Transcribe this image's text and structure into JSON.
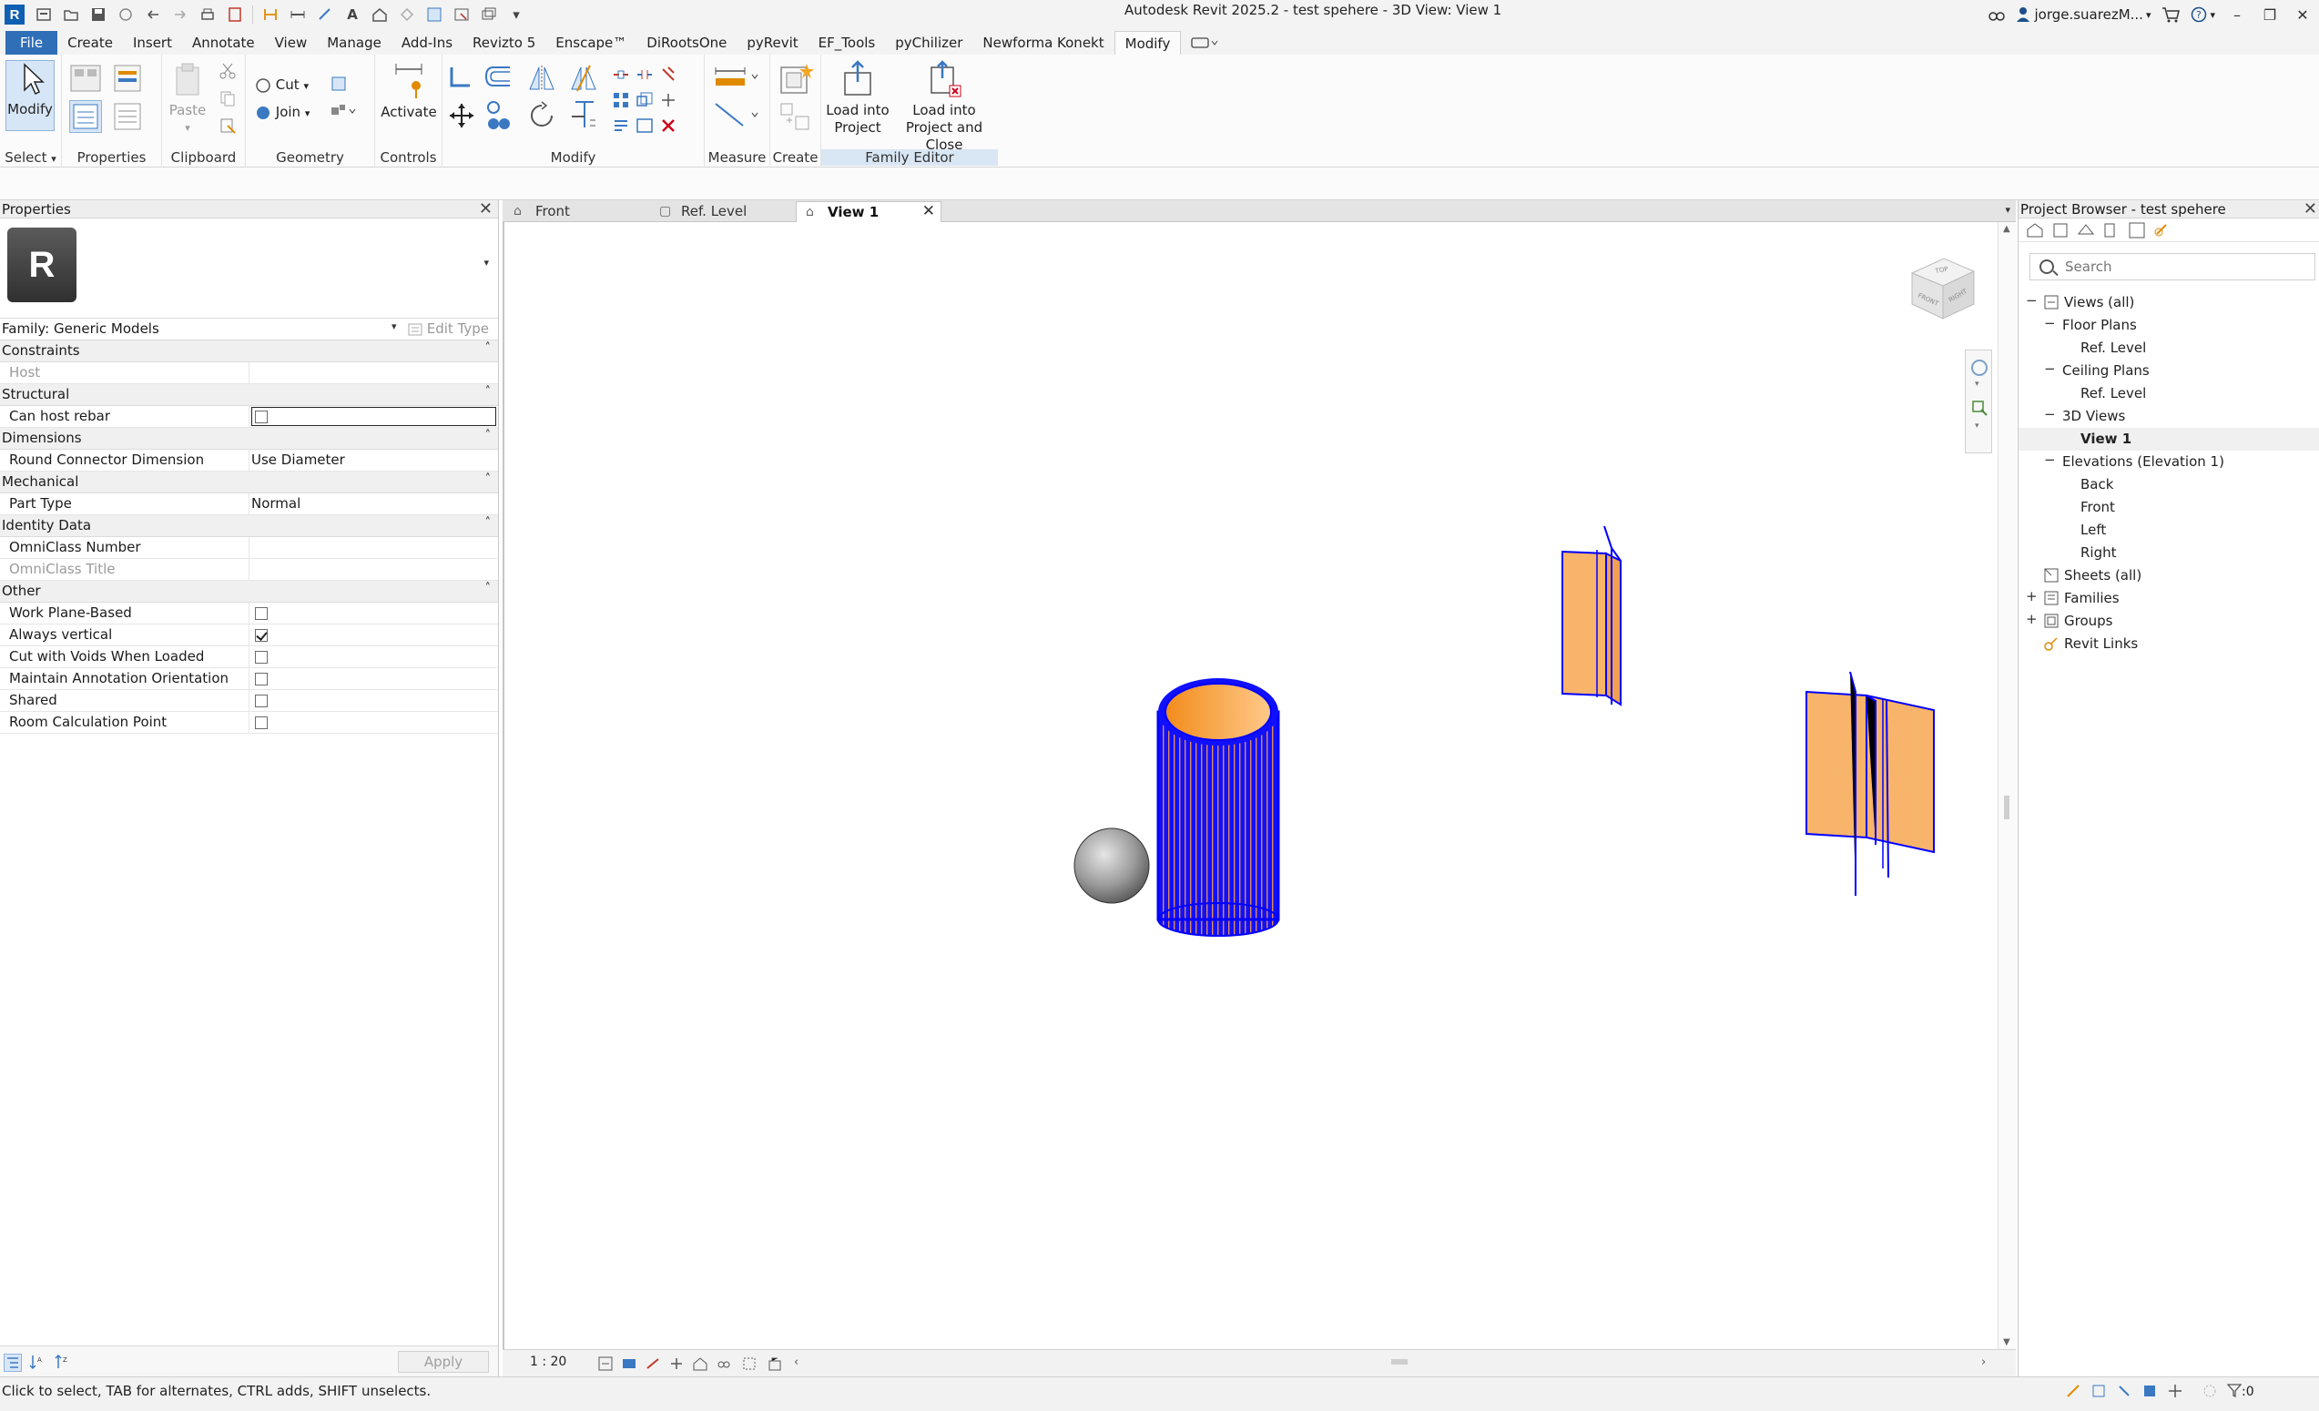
{
  "window": {
    "title": "Autodesk Revit 2025.2 - test spehere - 3D View: View 1",
    "user": "jorge.suarezM...",
    "search_label": "",
    "colors": {
      "accent": "#2f6fb8",
      "selection_blue": "#0000ff",
      "element_orange": "#f8b46a"
    }
  },
  "ribbon": {
    "tabs": [
      {
        "label": "File"
      },
      {
        "label": "Create"
      },
      {
        "label": "Insert"
      },
      {
        "label": "Annotate"
      },
      {
        "label": "View"
      },
      {
        "label": "Manage"
      },
      {
        "label": "Add-Ins"
      },
      {
        "label": "Revizto 5"
      },
      {
        "label": "Enscape™"
      },
      {
        "label": "DiRootsOne"
      },
      {
        "label": "pyRevit"
      },
      {
        "label": "EF_Tools"
      },
      {
        "label": "pyChilizer"
      },
      {
        "label": "Newforma Konekt"
      },
      {
        "label": "Modify"
      }
    ],
    "active_tab": "Modify",
    "buttons": {
      "modify": "Modify",
      "paste": "Paste",
      "cut": "Cut",
      "join": "Join",
      "activate": "Activate",
      "load_into_project": "Load into Project",
      "load_into_project_close": "Load into Project and Close"
    },
    "panels": {
      "select": "Select",
      "properties": "Properties",
      "clipboard": "Clipboard",
      "geometry": "Geometry",
      "controls": "Controls",
      "modify": "Modify",
      "measure": "Measure",
      "create": "Create",
      "family_editor": "Family Editor"
    }
  },
  "properties": {
    "title": "Properties",
    "type_icon_letter": "R",
    "family": "Family: Generic Models",
    "edit_type": "Edit Type",
    "groups": {
      "constraints": "Constraints",
      "structural": "Structural",
      "dimensions": "Dimensions",
      "mechanical": "Mechanical",
      "identity": "Identity Data",
      "other": "Other"
    },
    "rows": {
      "host": {
        "name": "Host",
        "value": ""
      },
      "can_host_rebar": {
        "name": "Can host rebar",
        "checked": false
      },
      "round_connector": {
        "name": "Round Connector Dimension",
        "value": "Use Diameter"
      },
      "part_type": {
        "name": "Part Type",
        "value": "Normal"
      },
      "omniclass_number": {
        "name": "OmniClass Number",
        "value": ""
      },
      "omniclass_title": {
        "name": "OmniClass Title",
        "value": ""
      },
      "work_plane_based": {
        "name": "Work Plane-Based",
        "checked": false
      },
      "always_vertical": {
        "name": "Always vertical",
        "checked": true
      },
      "cut_with_voids": {
        "name": "Cut with Voids When Loaded",
        "checked": false
      },
      "maintain_annotation": {
        "name": "Maintain Annotation Orientation",
        "checked": false
      },
      "shared": {
        "name": "Shared",
        "checked": false
      },
      "room_calc_point": {
        "name": "Room Calculation Point",
        "checked": false
      }
    },
    "apply": "Apply"
  },
  "view": {
    "tabs": [
      {
        "label": "Front",
        "icon": "elevation-icon"
      },
      {
        "label": "Ref. Level",
        "icon": "floor-plan-icon"
      },
      {
        "label": "View 1",
        "icon": "3d-view-icon",
        "active": true
      }
    ],
    "scale": "1 : 20",
    "viewcube_faces": [
      "TOP",
      "FRONT",
      "RIGHT"
    ]
  },
  "browser": {
    "title": "Project Browser - test spehere",
    "search_placeholder": "Search",
    "tree": {
      "views_all": "Views (all)",
      "floor_plans": "Floor Plans",
      "fp_ref_level": "Ref. Level",
      "ceiling_plans": "Ceiling Plans",
      "cp_ref_level": "Ref. Level",
      "views_3d": "3D Views",
      "view1": "View 1",
      "elevations": "Elevations (Elevation 1)",
      "back": "Back",
      "front": "Front",
      "left": "Left",
      "right": "Right",
      "sheets": "Sheets (all)",
      "families": "Families",
      "groups": "Groups",
      "revit_links": "Revit Links"
    }
  },
  "status": {
    "message": "Click to select, TAB for alternates, CTRL adds, SHIFT unselects.",
    "filter_count": ":0"
  }
}
